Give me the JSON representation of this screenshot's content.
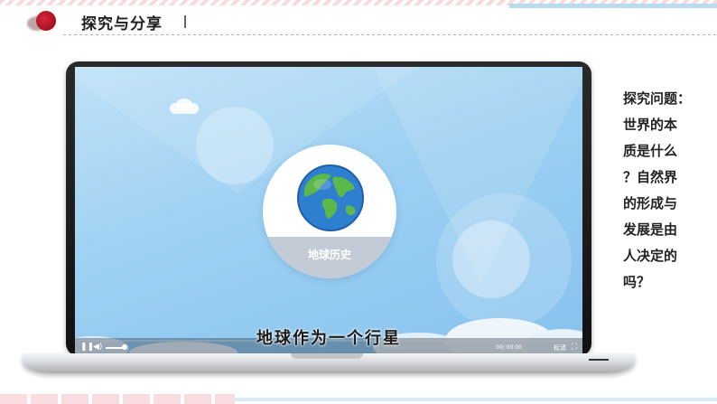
{
  "header": {
    "title": "探究与分享"
  },
  "video": {
    "badge_label": "地球历史",
    "subtitle": "地球作为一个行星",
    "time": "00/ 00:00",
    "quality_label": "标清"
  },
  "question": {
    "lines": [
      "探究问题：",
      "世界的本",
      "质是什么",
      "？自然界",
      "的形成与",
      "发展是由",
      "人决定的",
      "吗？"
    ]
  },
  "colors": {
    "accent_red": "#c0172a",
    "screen_blue": "#9dd0f2"
  }
}
